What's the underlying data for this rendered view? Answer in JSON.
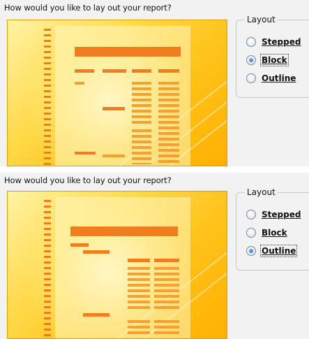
{
  "panels": [
    {
      "prompt": "How would you like to lay out your report?",
      "layout_group_title": "Layout",
      "options": [
        {
          "label": "Stepped",
          "selected": false
        },
        {
          "label": "Block",
          "selected": true
        },
        {
          "label": "Outline",
          "selected": false
        }
      ]
    },
    {
      "prompt": "How would you like to lay out your report?",
      "layout_group_title": "Layout",
      "options": [
        {
          "label": "Stepped",
          "selected": false
        },
        {
          "label": "Block",
          "selected": false
        },
        {
          "label": "Outline",
          "selected": true
        }
      ]
    }
  ],
  "colors": {
    "preview_orange": "#f07d1e",
    "preview_yellow": "#ffd94a",
    "radio_selected": "#1f5fc8"
  }
}
